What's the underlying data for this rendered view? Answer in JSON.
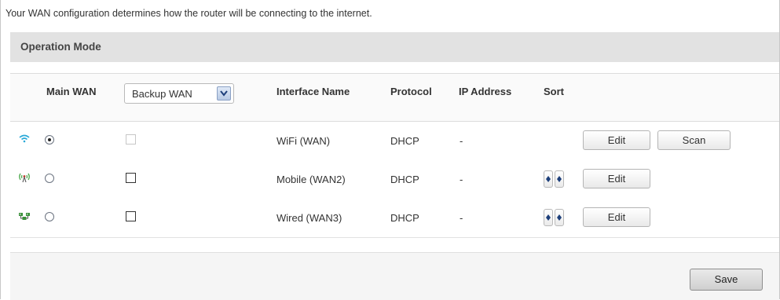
{
  "intro_text": "Your WAN configuration determines how the router will be connecting to the internet.",
  "section": {
    "title": "Operation Mode"
  },
  "table": {
    "headers": {
      "main_wan": "Main WAN",
      "backup_select": "Backup WAN",
      "interface_name": "Interface Name",
      "protocol": "Protocol",
      "ip_address": "IP Address",
      "sort": "Sort"
    },
    "rows": [
      {
        "icon": "wifi-icon",
        "main_wan_selected": true,
        "backup_enabled": false,
        "backup_checked": false,
        "interface": "WiFi (WAN)",
        "protocol": "DHCP",
        "ip": "-",
        "edit_label": "Edit",
        "scan_label": "Scan"
      },
      {
        "icon": "mobile-antenna-icon",
        "main_wan_selected": false,
        "backup_enabled": true,
        "backup_checked": false,
        "interface": "Mobile (WAN2)",
        "protocol": "DHCP",
        "ip": "-",
        "edit_label": "Edit"
      },
      {
        "icon": "wired-network-icon",
        "main_wan_selected": false,
        "backup_enabled": true,
        "backup_checked": false,
        "interface": "Wired (WAN3)",
        "protocol": "DHCP",
        "ip": "-",
        "edit_label": "Edit"
      }
    ]
  },
  "footer": {
    "save_label": "Save"
  }
}
